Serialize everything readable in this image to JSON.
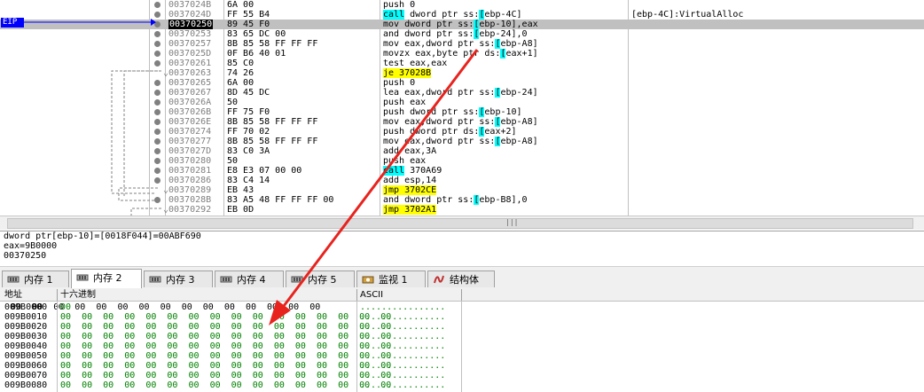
{
  "disasm": {
    "rows": [
      {
        "addr": "0037024B",
        "bytes": "6A 00",
        "instr": "push 0",
        "comment": "",
        "mark": "dot"
      },
      {
        "addr": "0037024D",
        "bytes": "FF 55 B4",
        "instr": "call dword ptr ss:[ebp-4C]",
        "comment": "[ebp-4C]:VirtualAlloc",
        "mark": "dot"
      },
      {
        "addr": "00370250",
        "bytes": "89 45 F0",
        "instr": "mov dword ptr ss:[ebp-10],eax",
        "comment": "",
        "mark": "dot",
        "selected": true
      },
      {
        "addr": "00370253",
        "bytes": "83 65 DC 00",
        "instr": "and dword ptr ss:[ebp-24],0",
        "comment": "",
        "mark": "dot"
      },
      {
        "addr": "00370257",
        "bytes": "8B 85 58 FF FF FF",
        "instr": "mov eax,dword ptr ss:[ebp-A8]",
        "comment": "",
        "mark": "dot"
      },
      {
        "addr": "0037025D",
        "bytes": "0F B6 40 01",
        "instr": "movzx eax,byte ptr ds:[eax+1]",
        "comment": "",
        "mark": "dot"
      },
      {
        "addr": "00370261",
        "bytes": "85 C0",
        "instr": "test eax,eax",
        "comment": "",
        "mark": "dot"
      },
      {
        "addr": "00370263",
        "bytes": "74 26",
        "instr": "je 37028B",
        "comment": "",
        "mark": "arrow"
      },
      {
        "addr": "00370265",
        "bytes": "6A 00",
        "instr": "push 0",
        "comment": "",
        "mark": "dot"
      },
      {
        "addr": "00370267",
        "bytes": "8D 45 DC",
        "instr": "lea eax,dword ptr ss:[ebp-24]",
        "comment": "",
        "mark": "dot"
      },
      {
        "addr": "0037026A",
        "bytes": "50",
        "instr": "push eax",
        "comment": "",
        "mark": "dot"
      },
      {
        "addr": "0037026B",
        "bytes": "FF 75 F0",
        "instr": "push dword ptr ss:[ebp-10]",
        "comment": "",
        "mark": "dot"
      },
      {
        "addr": "0037026E",
        "bytes": "8B 85 58 FF FF FF",
        "instr": "mov eax,dword ptr ss:[ebp-A8]",
        "comment": "",
        "mark": "dot"
      },
      {
        "addr": "00370274",
        "bytes": "FF 70 02",
        "instr": "push dword ptr ds:[eax+2]",
        "comment": "",
        "mark": "dot"
      },
      {
        "addr": "00370277",
        "bytes": "8B 85 58 FF FF FF",
        "instr": "mov eax,dword ptr ss:[ebp-A8]",
        "comment": "",
        "mark": "dot"
      },
      {
        "addr": "0037027D",
        "bytes": "83 C0 3A",
        "instr": "add eax,3A",
        "comment": "",
        "mark": "dot"
      },
      {
        "addr": "00370280",
        "bytes": "50",
        "instr": "push eax",
        "comment": "",
        "mark": "dot"
      },
      {
        "addr": "00370281",
        "bytes": "E8 E3 07 00 00",
        "instr": "call 370A69",
        "comment": "",
        "mark": "dot"
      },
      {
        "addr": "00370286",
        "bytes": "83 C4 14",
        "instr": "add esp,14",
        "comment": "",
        "mark": "dot"
      },
      {
        "addr": "00370289",
        "bytes": "EB 43",
        "instr": "jmp 3702CE",
        "comment": "",
        "mark": "arrow"
      },
      {
        "addr": "0037028B",
        "bytes": "83 A5 48 FF FF FF 00",
        "instr": "and dword ptr ss:[ebp-B8],0",
        "comment": "",
        "mark": "dot"
      },
      {
        "addr": "00370292",
        "bytes": "EB 0D",
        "instr": "jmp 3702A1",
        "comment": "",
        "mark": "arrow"
      }
    ],
    "eip_label": "EIP"
  },
  "info": {
    "line1": "dword ptr[ebp-10]=[0018F044]=00ABF690",
    "line2": "eax=9B0000",
    "line3": "00370250"
  },
  "tabs": [
    {
      "label": "内存 1",
      "active": false,
      "icon": "memory-icon"
    },
    {
      "label": "内存 2",
      "active": true,
      "icon": "memory-icon"
    },
    {
      "label": "内存 3",
      "active": false,
      "icon": "memory-icon"
    },
    {
      "label": "内存 4",
      "active": false,
      "icon": "memory-icon"
    },
    {
      "label": "内存 5",
      "active": false,
      "icon": "memory-icon"
    },
    {
      "label": "监视 1",
      "active": false,
      "icon": "watch-icon"
    },
    {
      "label": "结构体",
      "active": false,
      "icon": "struct-icon"
    }
  ],
  "memory": {
    "headers": {
      "address": "地址",
      "hex": "十六进制",
      "ascii": "ASCII"
    },
    "rows": [
      {
        "addr": "009B0000",
        "hex": "00 00 00 00 00 00 00 00 00 00 00 00 00 00 00 00",
        "ascii": "................"
      },
      {
        "addr": "009B0010",
        "hex": "00 00 00 00 00 00 00 00 00 00 00 00 00 00 00 00",
        "ascii": "................"
      },
      {
        "addr": "009B0020",
        "hex": "00 00 00 00 00 00 00 00 00 00 00 00 00 00 00 00",
        "ascii": "................"
      },
      {
        "addr": "009B0030",
        "hex": "00 00 00 00 00 00 00 00 00 00 00 00 00 00 00 00",
        "ascii": "................"
      },
      {
        "addr": "009B0040",
        "hex": "00 00 00 00 00 00 00 00 00 00 00 00 00 00 00 00",
        "ascii": "................"
      },
      {
        "addr": "009B0050",
        "hex": "00 00 00 00 00 00 00 00 00 00 00 00 00 00 00 00",
        "ascii": "................"
      },
      {
        "addr": "009B0060",
        "hex": "00 00 00 00 00 00 00 00 00 00 00 00 00 00 00 00",
        "ascii": "................"
      },
      {
        "addr": "009B0070",
        "hex": "00 00 00 00 00 00 00 00 00 00 00 00 00 00 00 00",
        "ascii": "................"
      },
      {
        "addr": "009B0080",
        "hex": "00 00 00 00 00 00 00 00 00 00 00 00 00 00 00 00",
        "ascii": "................"
      }
    ]
  },
  "colors": {
    "accent": "#0000ff",
    "highlight_cyan": "#00ffff",
    "highlight_yellow": "#ffff00",
    "annotation_red": "#e8231e",
    "memory_green": "#008000"
  }
}
